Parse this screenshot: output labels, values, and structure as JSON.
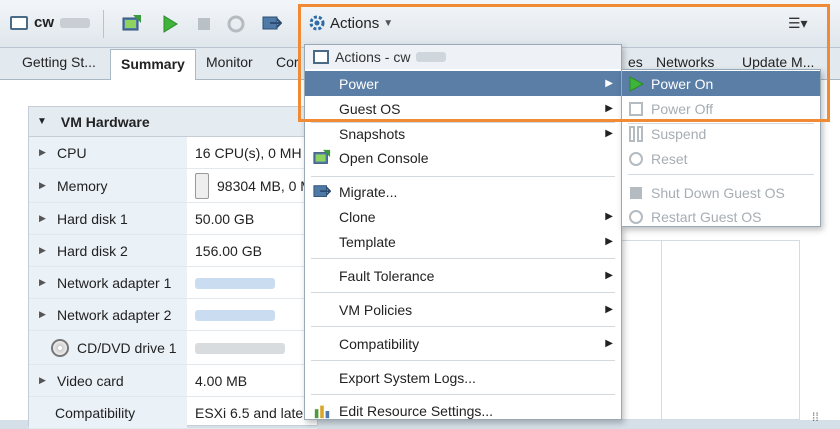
{
  "toolbar": {
    "vm_name": "cw",
    "actions_label": "Actions",
    "right_menu_glyph": "☰▾",
    "icons": [
      "open-console-icon",
      "power-on-icon",
      "power-off-icon",
      "refresh-icon",
      "migrate-icon"
    ]
  },
  "tabs": [
    {
      "label": "Getting St...",
      "active": false
    },
    {
      "label": "Summary",
      "active": true
    },
    {
      "label": "Monitor",
      "active": false
    },
    {
      "label": "Cor",
      "active": false
    },
    {
      "label": "es",
      "active": false
    },
    {
      "label": "Networks",
      "active": false
    },
    {
      "label": "Update M...",
      "active": false
    }
  ],
  "vm_hardware": {
    "title": "VM Hardware",
    "rows": [
      {
        "key": "CPU",
        "value": "16 CPU(s), 0 MH"
      },
      {
        "key": "Memory",
        "value": "98304 MB, 0 M"
      },
      {
        "key": "Hard disk 1",
        "value": "50.00 GB"
      },
      {
        "key": "Hard disk 2",
        "value": "156.00 GB"
      },
      {
        "key": "Network adapter 1",
        "value": ""
      },
      {
        "key": "Network adapter 2",
        "value": ""
      },
      {
        "key": "CD/DVD drive 1",
        "value": ""
      },
      {
        "key": "Video card",
        "value": "4.00 MB"
      },
      {
        "key": "Compatibility",
        "value": "ESXi 6.5 and late"
      }
    ]
  },
  "actions_menu": {
    "header": "Actions - cw",
    "items": [
      {
        "label": "Power",
        "submenu": true,
        "highlighted": true
      },
      {
        "label": "Guest OS",
        "submenu": true
      },
      {
        "label": "Snapshots",
        "submenu": true
      },
      {
        "label": "Open Console",
        "submenu": false
      },
      {
        "label": "Migrate...",
        "submenu": false
      },
      {
        "label": "Clone",
        "submenu": true
      },
      {
        "label": "Template",
        "submenu": true
      },
      {
        "label": "Fault Tolerance",
        "submenu": true
      },
      {
        "label": "VM Policies",
        "submenu": true
      },
      {
        "label": "Compatibility",
        "submenu": true
      },
      {
        "label": "Export System Logs...",
        "submenu": false
      },
      {
        "label": "Edit Resource Settings...",
        "submenu": false
      }
    ]
  },
  "power_submenu": {
    "items": [
      {
        "label": "Power On",
        "enabled": true,
        "highlighted": true
      },
      {
        "label": "Power Off",
        "enabled": false
      },
      {
        "label": "Suspend",
        "enabled": false
      },
      {
        "label": "Reset",
        "enabled": false
      },
      {
        "label": "Shut Down Guest OS",
        "enabled": false
      },
      {
        "label": "Restart Guest OS",
        "enabled": false
      }
    ]
  },
  "colors": {
    "highlight": "#5a7ea6",
    "annotation_frame": "#f08a35",
    "power_on_green": "#3fb43a"
  }
}
